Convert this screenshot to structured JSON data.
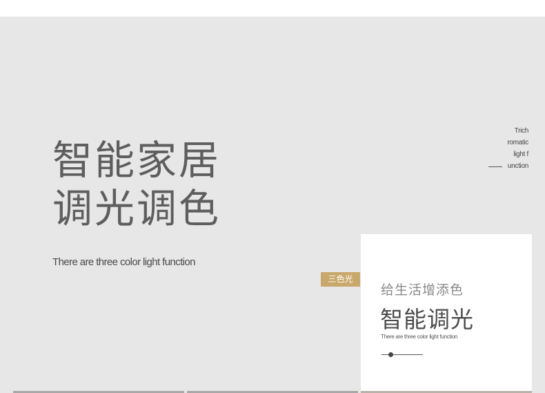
{
  "hero": {
    "title_line1": "智能家居",
    "title_line2": "调光调色",
    "subtitle": "There are three color light function"
  },
  "side": {
    "line1": "Trich",
    "line2": "romatic",
    "line3": "light f",
    "line4": "unction"
  },
  "tag": {
    "label": "三色光"
  },
  "card": {
    "subtitle": "给生活增添色",
    "title": "智能调光",
    "text": "There are three color light function"
  },
  "colors": {
    "accent": "#c9a86b",
    "panel": "#e7e7e7"
  }
}
